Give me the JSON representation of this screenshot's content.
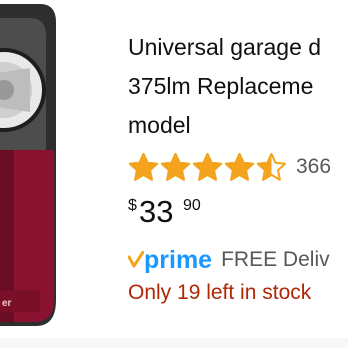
{
  "product": {
    "title_lines": [
      "Universal garage d",
      "375lm Replaceme",
      "model"
    ],
    "rating": {
      "value": 4.5,
      "max": 5,
      "count": "366",
      "star_color": "#f4a41c"
    },
    "price": {
      "symbol": "$",
      "whole": "33",
      "fraction": "90"
    },
    "prime": {
      "logo_text": "prime",
      "delivery_text": "FREE Deliv",
      "brand_color": "#1a98ff",
      "check_color": "#f7a21b"
    },
    "stock_text": "Only 19 left in stock",
    "image": {
      "icon": "garage-door-opener-light-image",
      "body_color": "#8a1230",
      "frame_color": "#3a3a3a",
      "brand_text": "er"
    }
  }
}
